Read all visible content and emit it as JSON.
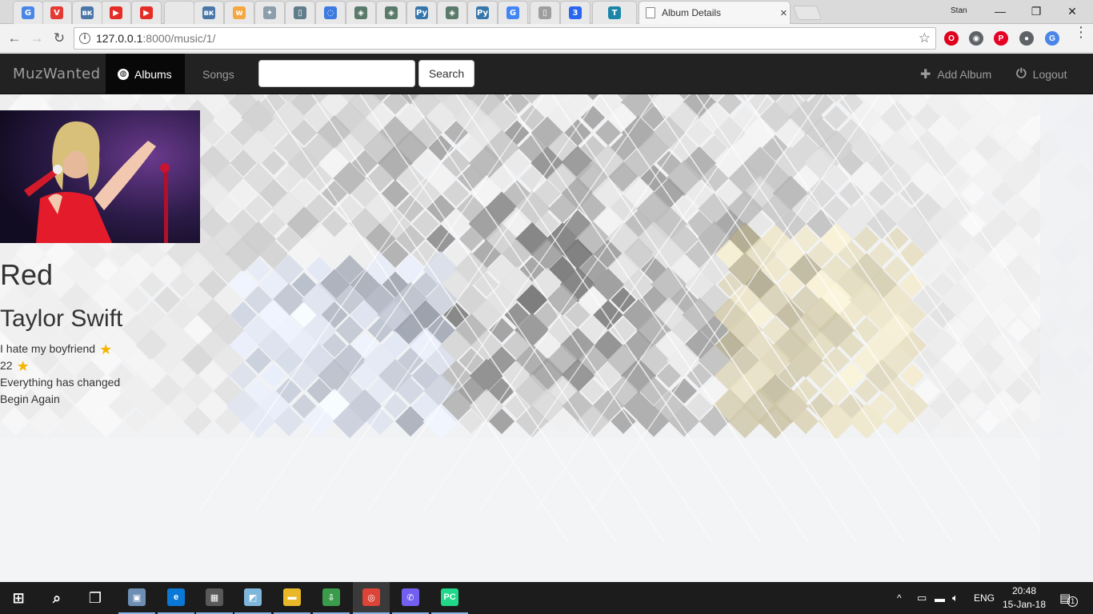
{
  "browser": {
    "tabs": [
      {
        "icon": "google-translate-icon",
        "color": "#4a86e8",
        "glyph": "G"
      },
      {
        "icon": "vk-saver-icon",
        "color": "#e53935",
        "glyph": "V"
      },
      {
        "icon": "vk-icon",
        "color": "#4a76a8",
        "glyph": "вк"
      },
      {
        "icon": "youtube-icon",
        "color": "#e52d27",
        "glyph": "▶"
      },
      {
        "icon": "youtube-icon",
        "color": "#e52d27",
        "glyph": "▶"
      },
      {
        "icon": "blank-page-icon",
        "color": "#e8e8e8",
        "glyph": ""
      },
      {
        "icon": "vk-icon",
        "color": "#4a76a8",
        "glyph": "вк"
      },
      {
        "icon": "w-icon",
        "color": "#f4a742",
        "glyph": "w"
      },
      {
        "icon": "puzzle-icon",
        "color": "#8c9eaa",
        "glyph": "✦"
      },
      {
        "icon": "document-icon",
        "color": "#607d8b",
        "glyph": "▯"
      },
      {
        "icon": "loading-icon",
        "color": "#3d7be0",
        "glyph": "◌"
      },
      {
        "icon": "django-diamond-icon",
        "color": "#5a7a6a",
        "glyph": "◈"
      },
      {
        "icon": "django-diamond-icon",
        "color": "#5a7a6a",
        "glyph": "◈"
      },
      {
        "icon": "python-icon",
        "color": "#3776ab",
        "glyph": "Py"
      },
      {
        "icon": "django-diamond-icon",
        "color": "#5a7a6a",
        "glyph": "◈"
      },
      {
        "icon": "python-icon",
        "color": "#3776ab",
        "glyph": "Py"
      },
      {
        "icon": "google-icon",
        "color": "#4285f4",
        "glyph": "G"
      },
      {
        "icon": "document-icon",
        "color": "#9e9e9e",
        "glyph": "▯"
      },
      {
        "icon": "css3-icon",
        "color": "#2965f1",
        "glyph": "3"
      },
      {
        "icon": "django-rest-icon",
        "color": "#1b86a8",
        "glyph": "T"
      }
    ],
    "active_tab_title": "Album Details",
    "active_tab_close": "×",
    "user": "Stan",
    "window_controls": {
      "minimize": "—",
      "restore": "❐",
      "close": "✕"
    },
    "nav": {
      "back": "←",
      "forward": "→",
      "reload": "↻"
    },
    "url_host": "127.0.0.1",
    "url_rest": ":8000/music/1/",
    "bookmark_star": "☆",
    "extensions": [
      {
        "name": "opera-icon",
        "color": "#e0001b",
        "glyph": "O"
      },
      {
        "name": "extension-shield-icon",
        "color": "#5f6368",
        "glyph": "◉"
      },
      {
        "name": "pinterest-icon",
        "color": "#e60023",
        "glyph": "P"
      },
      {
        "name": "location-pin-icon",
        "color": "#5f6368",
        "glyph": "●"
      },
      {
        "name": "translate-icon",
        "color": "#4a86e8",
        "glyph": "G"
      }
    ],
    "menu_dots": "⋮"
  },
  "site": {
    "brand": "MuzWanted",
    "nav_albums": "Albums",
    "nav_songs": "Songs",
    "search_placeholder": "",
    "search_button": "Search",
    "add_album": "Add Album",
    "logout": "Logout",
    "icons": {
      "albums": "globe-icon",
      "add": "plus-icon",
      "logout": "power-icon"
    }
  },
  "album": {
    "title": "Red",
    "artist": "Taylor Swift",
    "songs": [
      {
        "title": "I hate my boyfriend",
        "favorite": true
      },
      {
        "title": "22",
        "favorite": true
      },
      {
        "title": "Everything has changed",
        "favorite": false
      },
      {
        "title": "Begin Again",
        "favorite": false
      }
    ],
    "favorite_glyph": "★"
  },
  "taskbar": {
    "apps": [
      {
        "name": "start-icon",
        "glyph": "⊞",
        "color": "#1c1c1c"
      },
      {
        "name": "search-icon",
        "glyph": "⌕",
        "color": "#1c1c1c"
      },
      {
        "name": "task-view-icon",
        "glyph": "❐",
        "color": "#1c1c1c"
      },
      {
        "name": "photo-app-icon",
        "glyph": "▣",
        "color": "#6d8fb3"
      },
      {
        "name": "edge-icon",
        "glyph": "e",
        "color": "#0a78d7"
      },
      {
        "name": "calculator-icon",
        "glyph": "▦",
        "color": "#595959"
      },
      {
        "name": "notepad-icon",
        "glyph": "◩",
        "color": "#7fb6dc"
      },
      {
        "name": "file-explorer-icon",
        "glyph": "▬",
        "color": "#e8b829"
      },
      {
        "name": "downloader-icon",
        "glyph": "⇩",
        "color": "#3a9b4a"
      },
      {
        "name": "chrome-icon",
        "glyph": "◎",
        "color": "#db4437"
      },
      {
        "name": "viber-icon",
        "glyph": "✆",
        "color": "#7360f2"
      },
      {
        "name": "pycharm-icon",
        "glyph": "PC",
        "color": "#21d789"
      }
    ],
    "tray": {
      "chevron": "^",
      "lang": "ENG"
    },
    "time": "20:48",
    "date": "15-Jan-18",
    "notifications": "1"
  }
}
